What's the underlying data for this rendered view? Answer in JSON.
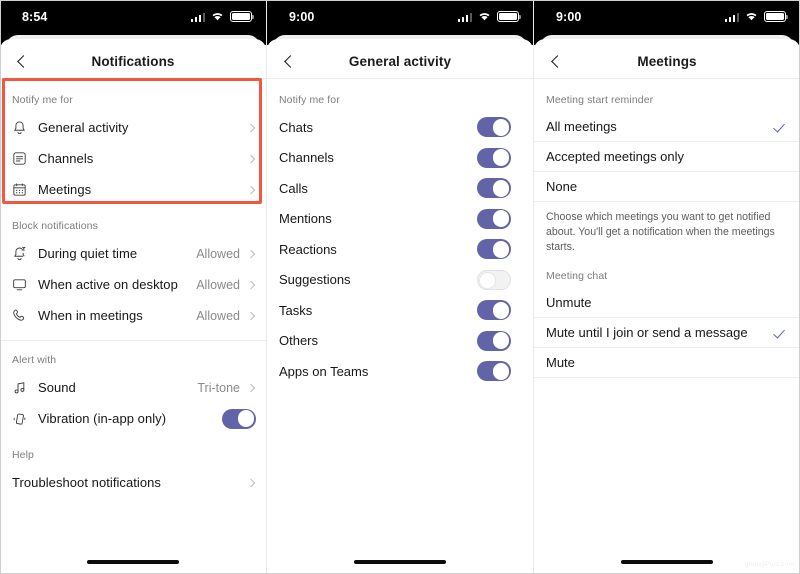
{
  "panels": [
    {
      "status": {
        "time": "8:54",
        "icons": [
          "cellular-icon",
          "wifi-icon",
          "battery-icon"
        ]
      },
      "nav": {
        "back": "back-chevron-icon",
        "title": "Notifications"
      },
      "sections": [
        {
          "heading": "Notify me for",
          "highlighted": true,
          "rows": [
            {
              "icon": "bell-icon",
              "label": "General activity",
              "value": "",
              "accessory": "chevron"
            },
            {
              "icon": "channels-icon",
              "label": "Channels",
              "value": "",
              "accessory": "chevron"
            },
            {
              "icon": "calendar-icon",
              "label": "Meetings",
              "value": "",
              "accessory": "chevron"
            }
          ]
        },
        {
          "heading": "Block notifications",
          "rows": [
            {
              "icon": "bell-quiet-icon",
              "label": "During quiet time",
              "value": "Allowed",
              "accessory": "chevron"
            },
            {
              "icon": "monitor-icon",
              "label": "When active on desktop",
              "value": "Allowed",
              "accessory": "chevron"
            },
            {
              "icon": "phone-icon",
              "label": "When in meetings",
              "value": "Allowed",
              "accessory": "chevron"
            }
          ]
        },
        {
          "heading": "Alert with",
          "divider_before": true,
          "rows": [
            {
              "icon": "music-note-icon",
              "label": "Sound",
              "value": "Tri-tone",
              "accessory": "chevron"
            },
            {
              "icon": "vibration-icon",
              "label": "Vibration (in-app only)",
              "value": "",
              "accessory": "toggle",
              "toggle_on": true
            }
          ]
        },
        {
          "heading": "Help",
          "rows": [
            {
              "icon": "",
              "label": "Troubleshoot notifications",
              "value": "",
              "accessory": "chevron"
            }
          ]
        }
      ]
    },
    {
      "status": {
        "time": "9:00",
        "icons": [
          "cellular-icon",
          "wifi-icon",
          "battery-icon"
        ]
      },
      "nav": {
        "back": "back-chevron-icon",
        "title": "General activity"
      },
      "heading": "Notify me for",
      "toggles": [
        {
          "label": "Chats",
          "on": true
        },
        {
          "label": "Channels",
          "on": true
        },
        {
          "label": "Calls",
          "on": true
        },
        {
          "label": "Mentions",
          "on": true
        },
        {
          "label": "Reactions",
          "on": true
        },
        {
          "label": "Suggestions",
          "on": false
        },
        {
          "label": "Tasks",
          "on": true
        },
        {
          "label": "Others",
          "on": true
        },
        {
          "label": "Apps on Teams",
          "on": true
        }
      ]
    },
    {
      "status": {
        "time": "9:00",
        "icons": [
          "cellular-icon",
          "wifi-icon",
          "battery-icon"
        ]
      },
      "nav": {
        "back": "back-chevron-icon",
        "title": "Meetings"
      },
      "groups": [
        {
          "heading": "Meeting start reminder",
          "options": [
            {
              "label": "All meetings",
              "selected": true
            },
            {
              "label": "Accepted meetings only",
              "selected": false
            },
            {
              "label": "None",
              "selected": false
            }
          ],
          "helper": "Choose which meetings you want to get notified about. You'll get a notification when the meetings starts."
        },
        {
          "heading": "Meeting chat",
          "options": [
            {
              "label": "Unmute",
              "selected": false
            },
            {
              "label": "Mute until I join or send a message",
              "selected": true
            },
            {
              "label": "Mute",
              "selected": false
            }
          ],
          "helper": ""
        }
      ]
    }
  ],
  "watermark": "groovyPost.com",
  "colors": {
    "toggle_on": "#6264A7",
    "check": "#5B5FC7",
    "highlight_box": "#F4563E",
    "status_bar": "#000000"
  }
}
